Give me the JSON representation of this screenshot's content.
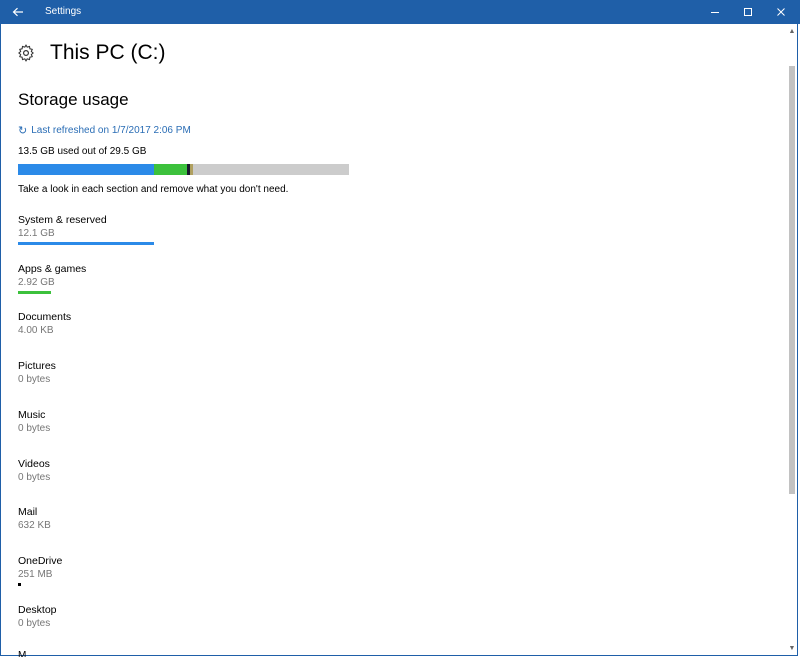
{
  "window": {
    "title": "Settings"
  },
  "header": {
    "title": "This PC (C:)"
  },
  "storage": {
    "section_title": "Storage usage",
    "refresh_label": "Last refreshed on 1/7/2017 2:06 PM",
    "usage_text": "13.5 GB used out of 29.5 GB",
    "hint": "Take a look in each section and remove what you don't need.",
    "bar_segments": [
      {
        "label": "System & reserved",
        "fraction": 0.41,
        "color": "#2b8ae8"
      },
      {
        "label": "Apps & games",
        "fraction": 0.099,
        "color": "#3cc13c"
      },
      {
        "label": "OneDrive",
        "fraction": 0.009,
        "color": "#1a1a2e"
      },
      {
        "label": "Other",
        "fraction": 0.008,
        "color": "#b0a060"
      }
    ],
    "bar_track_color": "#cccccc"
  },
  "categories": [
    {
      "name": "System & reserved",
      "size": "12.1 GB",
      "fraction": 0.41,
      "color": "#2b8ae8"
    },
    {
      "name": "Apps & games",
      "size": "2.92 GB",
      "fraction": 0.099,
      "color": "#3cc13c"
    },
    {
      "name": "Documents",
      "size": "4.00 KB",
      "fraction": 0,
      "color": "#000000"
    },
    {
      "name": "Pictures",
      "size": "0 bytes",
      "fraction": 0,
      "color": "#000000"
    },
    {
      "name": "Music",
      "size": "0 bytes",
      "fraction": 0,
      "color": "#000000"
    },
    {
      "name": "Videos",
      "size": "0 bytes",
      "fraction": 0,
      "color": "#000000"
    },
    {
      "name": "Mail",
      "size": "632 KB",
      "fraction": 0,
      "color": "#000000"
    },
    {
      "name": "OneDrive",
      "size": "251 MB",
      "fraction": 0.009,
      "color": "#000000"
    },
    {
      "name": "Desktop",
      "size": "0 bytes",
      "fraction": 0,
      "color": "#000000"
    }
  ],
  "icons": {
    "back": "back-arrow-icon",
    "minimize": "minimize-icon",
    "maximize": "maximize-icon",
    "close": "close-icon",
    "settings": "gear-icon",
    "refresh": "refresh-icon"
  }
}
